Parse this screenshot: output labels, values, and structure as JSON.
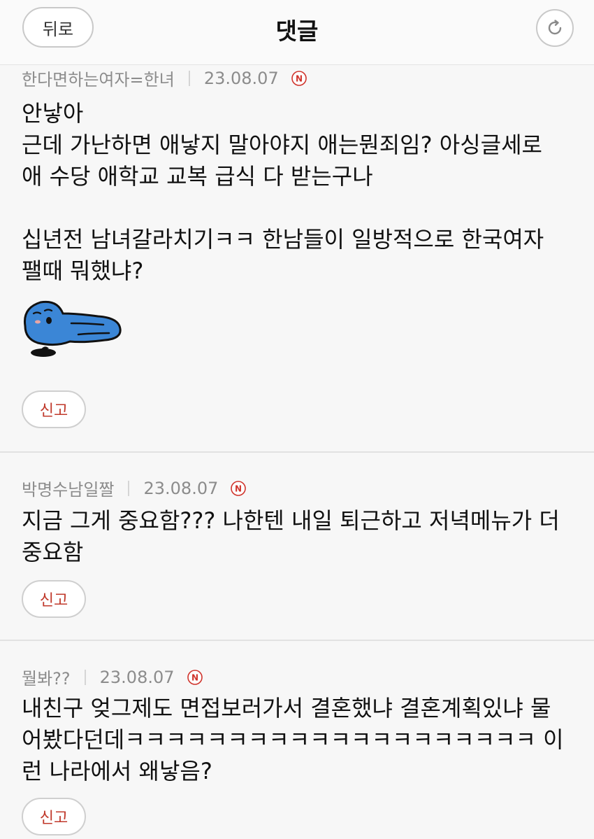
{
  "header": {
    "back_label": "뒤로",
    "title": "댓글",
    "refresh_icon": "refresh-icon"
  },
  "comments": [
    {
      "author": "한다면하는여자=한녀",
      "date": "23.08.07",
      "badge": "N",
      "text": "안낳아\n근데 가난하면 애낳지 말아야지 애는뭔죄임? 아싱글세로\n애 수당 애학교 교복 급식 다 받는구나\n\n십년전 남녀갈라치기ㅋㅋ 한남들이 일방적으로 한국여자\n팰때 뭐했냐?",
      "sticker_icon": "sleeping-blue-character-sticker",
      "report_label": "신고"
    },
    {
      "author": "박명수남일짤",
      "date": "23.08.07",
      "badge": "N",
      "text": "지금 그게 중요함??? 나한텐 내일 퇴근하고 저녁메뉴가 더\n중요함",
      "report_label": "신고"
    },
    {
      "author": "뭘봐??",
      "date": "23.08.07",
      "badge": "N",
      "text": "내친구 엊그제도 면접보러가서 결혼했냐 결혼계획있냐 물\n어봤다던데ㅋㅋㅋㅋㅋㅋㅋㅋㅋㅋㅋㅋㅋㅋㅋㅋㅋㅋㅋㅋ 이\n런 나라에서 왜낳음?",
      "report_label": "신고"
    }
  ],
  "colors": {
    "report_text": "#c0392b",
    "badge_red": "#d0342c",
    "sticker_blue": "#3b86d6"
  }
}
